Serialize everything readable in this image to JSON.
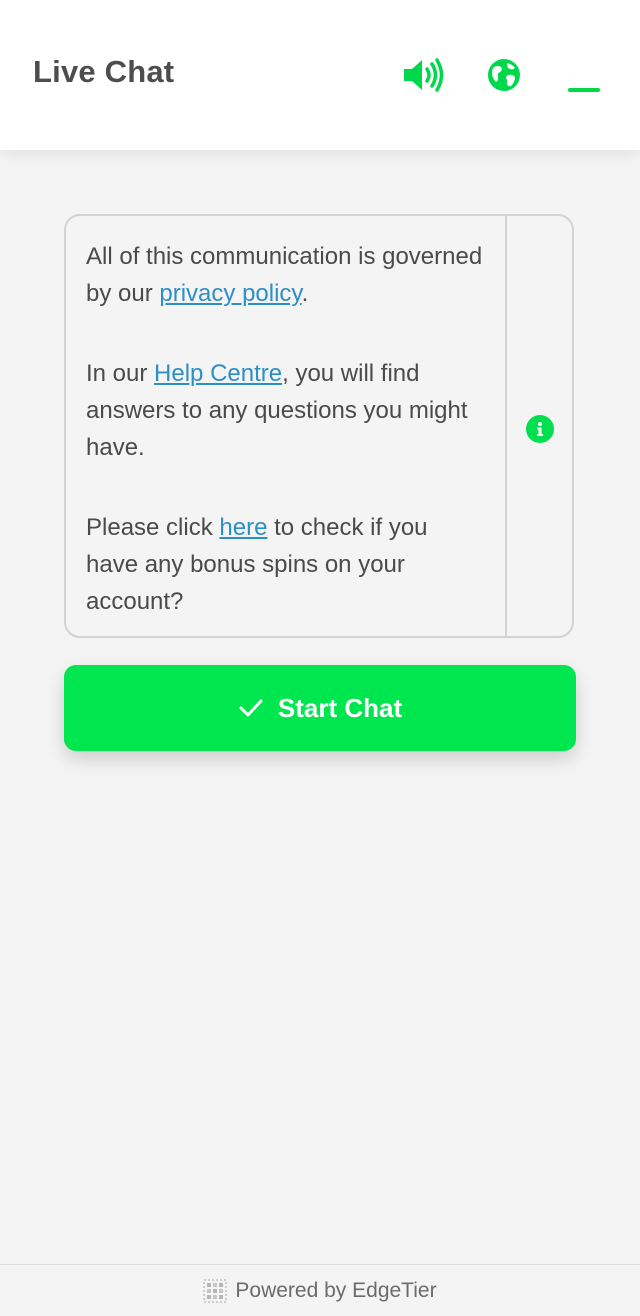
{
  "header": {
    "title": "Live Chat",
    "icons": [
      "volume-up-icon",
      "globe-icon",
      "minimize-icon"
    ]
  },
  "notice": {
    "p1_before": "All of this communication is governed by our ",
    "p1_link": "privacy policy",
    "p1_after": ".",
    "p2_before": "In our ",
    "p2_link": "Help Centre",
    "p2_after": ", you will find answers to any questions you might have.",
    "p3_before": "Please click ",
    "p3_link": "here",
    "p3_after": " to check if you have any bonus spins on your account?",
    "info_icon": "info-icon"
  },
  "actions": {
    "start_chat_label": "Start Chat",
    "start_chat_icon": "checkmark-icon"
  },
  "footer": {
    "text": "Powered by EdgeTier",
    "logo_icon": "edgetier-logo-icon"
  },
  "colors": {
    "accent": "#00e64f",
    "link": "#2c8fc7",
    "background": "#f4f4f4",
    "header_bg": "#ffffff",
    "text": "#4a4a4a"
  }
}
